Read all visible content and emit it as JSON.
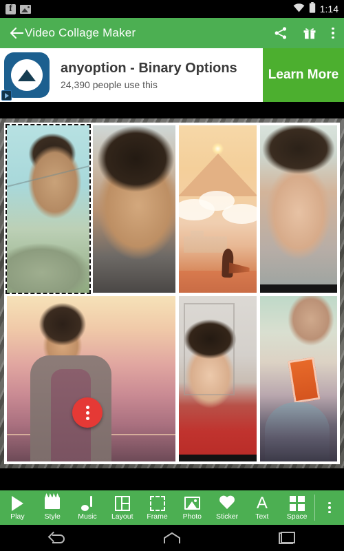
{
  "status_bar": {
    "time": "1:14",
    "icons": [
      "facebook-icon",
      "screenshot-icon",
      "wifi-icon",
      "battery-icon"
    ]
  },
  "app_bar": {
    "back_label": "",
    "title": "Video Collage Maker",
    "actions": [
      "share-icon",
      "gift-icon",
      "overflow-menu-icon"
    ],
    "background_color": "#4caf52"
  },
  "ad": {
    "title": "anyoption - Binary Options",
    "subtitle": "24,390 people use this",
    "cta_label": "Learn More",
    "cta_color": "#4caf2f",
    "icon": "anyoption-triangle-logo",
    "adchoices": "adchoices-icon"
  },
  "collage": {
    "frame_color": "#ffffff",
    "background": "metal-texture",
    "selected_cell_index": 0,
    "cells": [
      {
        "name": "photo-cell-1",
        "description": "young man smiling against teal sky",
        "selected": true
      },
      {
        "name": "photo-cell-2",
        "description": "close-up of man squinting"
      },
      {
        "name": "photo-cell-3",
        "description": "desert mountain with lone figure"
      },
      {
        "name": "photo-cell-4",
        "description": "man with wide eyes selfie"
      },
      {
        "name": "photo-cell-5",
        "description": "man in cardigan at sunset"
      },
      {
        "name": "photo-cell-6",
        "description": "man in red hoodie indoors"
      },
      {
        "name": "photo-cell-7",
        "description": "person holding popcorn box with cat"
      }
    ],
    "fab": {
      "name": "cell-options-fab",
      "icon": "more-vertical-icon",
      "color": "#e53935"
    }
  },
  "toolbar": {
    "background_color": "#4caf52",
    "items": [
      {
        "label": "Play",
        "icon": "play-icon"
      },
      {
        "label": "Style",
        "icon": "clapperboard-icon"
      },
      {
        "label": "Music",
        "icon": "music-note-icon"
      },
      {
        "label": "Layout",
        "icon": "layout-grid-icon"
      },
      {
        "label": "Frame",
        "icon": "frame-icon"
      },
      {
        "label": "Photo",
        "icon": "photo-icon"
      },
      {
        "label": "Sticker",
        "icon": "heart-icon"
      },
      {
        "label": "Text",
        "icon": "text-a-icon"
      },
      {
        "label": "Space",
        "icon": "space-grid-icon"
      }
    ],
    "overflow_icon": "overflow-menu-icon",
    "text_glyph": "A"
  },
  "nav_bar": {
    "buttons": [
      {
        "name": "nav-back",
        "icon": "back-arrow-icon"
      },
      {
        "name": "nav-home",
        "icon": "home-icon"
      },
      {
        "name": "nav-recents",
        "icon": "recents-icon"
      }
    ]
  }
}
